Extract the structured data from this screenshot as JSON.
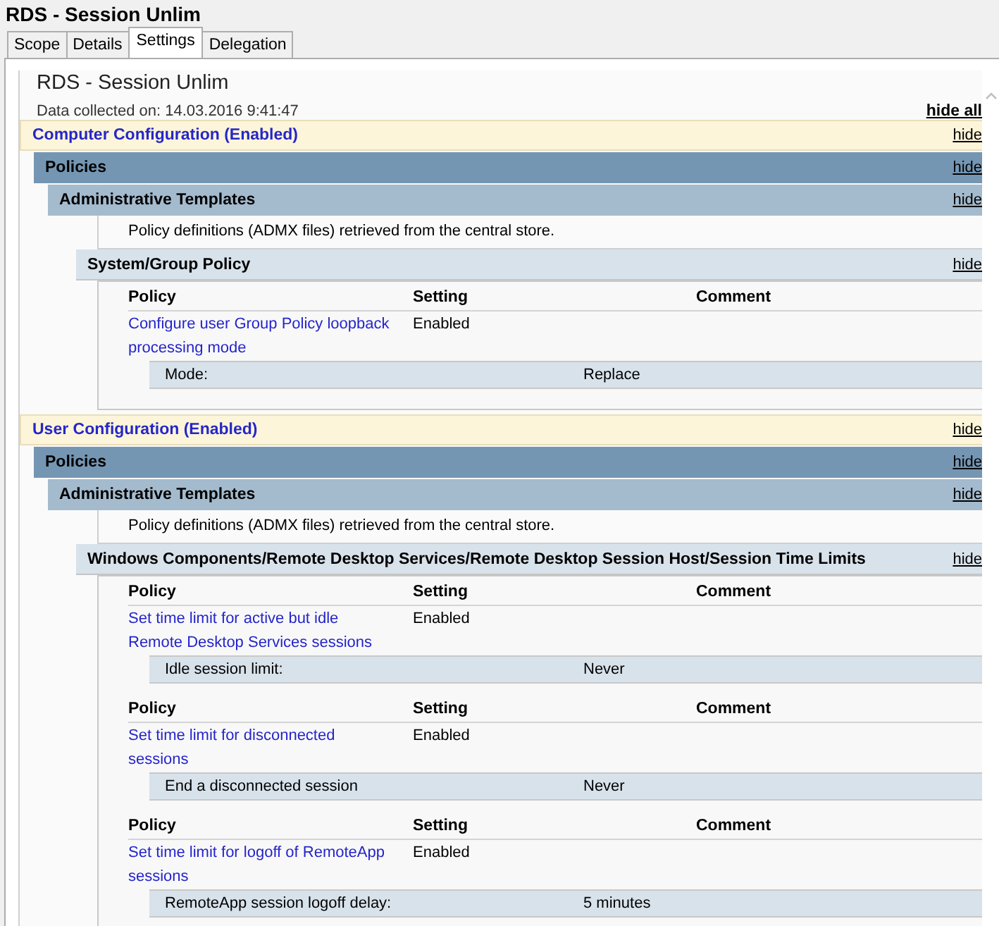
{
  "window": {
    "title": "RDS - Session Unlim"
  },
  "tabs": [
    {
      "label": "Scope",
      "selected": false
    },
    {
      "label": "Details",
      "selected": false
    },
    {
      "label": "Settings",
      "selected": true
    },
    {
      "label": "Delegation",
      "selected": false
    }
  ],
  "report": {
    "title": "RDS - Session Unlim",
    "collected": "Data collected on: 14.03.2016 9:41:47",
    "hide_all": "hide all"
  },
  "sections": [
    {
      "title": "Computer Configuration (Enabled)",
      "hide": "hide",
      "policies": {
        "title": "Policies",
        "hide": "hide",
        "templates": {
          "title": "Administrative Templates",
          "hide": "hide",
          "note": "Policy definitions (ADMX files) retrieved from the central store.",
          "categories": [
            {
              "title": "System/Group Policy",
              "hide": "hide",
              "policies": [
                {
                  "headers": [
                    "Policy",
                    "Setting",
                    "Comment"
                  ],
                  "name": "Configure user Group Policy loopback processing mode",
                  "setting": "Enabled",
                  "options": [
                    {
                      "label": "Mode:",
                      "value": "Replace"
                    }
                  ]
                }
              ]
            }
          ]
        }
      }
    },
    {
      "title": "User Configuration (Enabled)",
      "hide": "hide",
      "policies": {
        "title": "Policies",
        "hide": "hide",
        "templates": {
          "title": "Administrative Templates",
          "hide": "hide",
          "note": "Policy definitions (ADMX files) retrieved from the central store.",
          "categories": [
            {
              "title": "Windows Components/Remote Desktop Services/Remote Desktop Session Host/Session Time Limits",
              "hide": "hide",
              "policies": [
                {
                  "headers": [
                    "Policy",
                    "Setting",
                    "Comment"
                  ],
                  "name": "Set time limit for active but idle Remote Desktop Services sessions",
                  "setting": "Enabled",
                  "options": [
                    {
                      "label": "Idle session limit:",
                      "value": "Never"
                    }
                  ]
                },
                {
                  "headers": [
                    "Policy",
                    "Setting",
                    "Comment"
                  ],
                  "name": "Set time limit for disconnected sessions",
                  "setting": "Enabled",
                  "options": [
                    {
                      "label": "End a disconnected session",
                      "value": "Never"
                    }
                  ]
                },
                {
                  "headers": [
                    "Policy",
                    "Setting",
                    "Comment"
                  ],
                  "name": "Set time limit for logoff of RemoteApp sessions",
                  "setting": "Enabled",
                  "options": [
                    {
                      "label": "RemoteApp session logoff delay:",
                      "value": "5 minutes"
                    }
                  ]
                }
              ]
            }
          ]
        }
      }
    }
  ]
}
